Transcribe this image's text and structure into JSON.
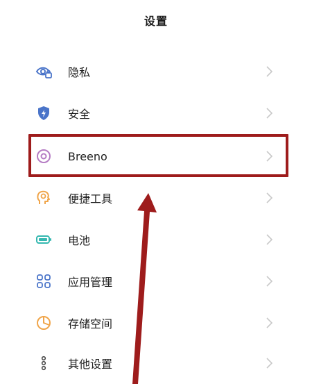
{
  "header": {
    "title": "设置"
  },
  "settings": {
    "items": [
      {
        "label": "隐私",
        "icon": "privacy-eye-icon"
      },
      {
        "label": "安全",
        "icon": "shield-lightning-icon"
      },
      {
        "label": "Breeno",
        "icon": "breeno-ring-icon"
      },
      {
        "label": "便捷工具",
        "icon": "head-gear-icon"
      },
      {
        "label": "电池",
        "icon": "battery-icon"
      },
      {
        "label": "应用管理",
        "icon": "app-grid-icon"
      },
      {
        "label": "存储空间",
        "icon": "storage-pie-icon"
      },
      {
        "label": "其他设置",
        "icon": "more-settings-icon"
      }
    ]
  },
  "colors": {
    "annotation": "#9e1c1c",
    "icon_blue": "#4a74c9",
    "icon_purple": "#b57cc4",
    "icon_orange": "#f0a54a",
    "icon_teal": "#35b8b0",
    "chevron": "#c9c9c9"
  }
}
